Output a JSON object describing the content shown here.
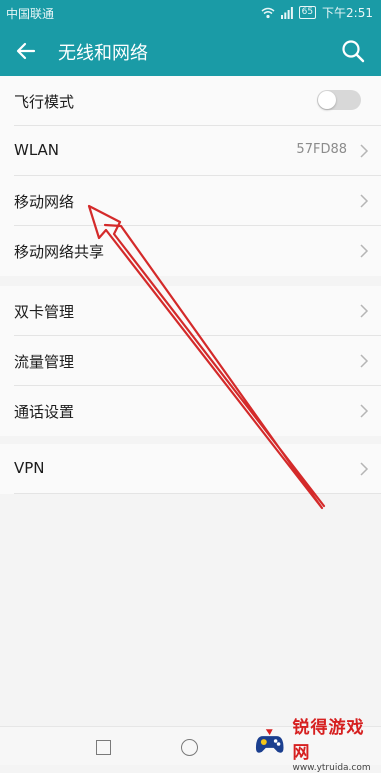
{
  "status_bar": {
    "carrier": "中国联通",
    "battery": "65",
    "time": "下午2:51"
  },
  "app_bar": {
    "title": "无线和网络"
  },
  "group1": [
    {
      "label": "飞行模式",
      "type": "toggle",
      "toggle_on": false
    },
    {
      "label": "WLAN",
      "value": "57FD88",
      "type": "nav"
    },
    {
      "label": "移动网络",
      "type": "nav"
    },
    {
      "label": "移动网络共享",
      "type": "nav"
    }
  ],
  "group2": [
    {
      "label": "双卡管理",
      "type": "nav"
    },
    {
      "label": "流量管理",
      "type": "nav"
    },
    {
      "label": "通话设置",
      "type": "nav"
    }
  ],
  "group3": [
    {
      "label": "VPN",
      "type": "nav"
    }
  ],
  "annotation": {
    "arrow_color": "#d42a2a"
  },
  "watermark": {
    "brand": "锐得游戏网",
    "url": "www.ytruida.com"
  },
  "colors": {
    "accent": "#1a9ba6",
    "background": "#f4f4f4"
  }
}
